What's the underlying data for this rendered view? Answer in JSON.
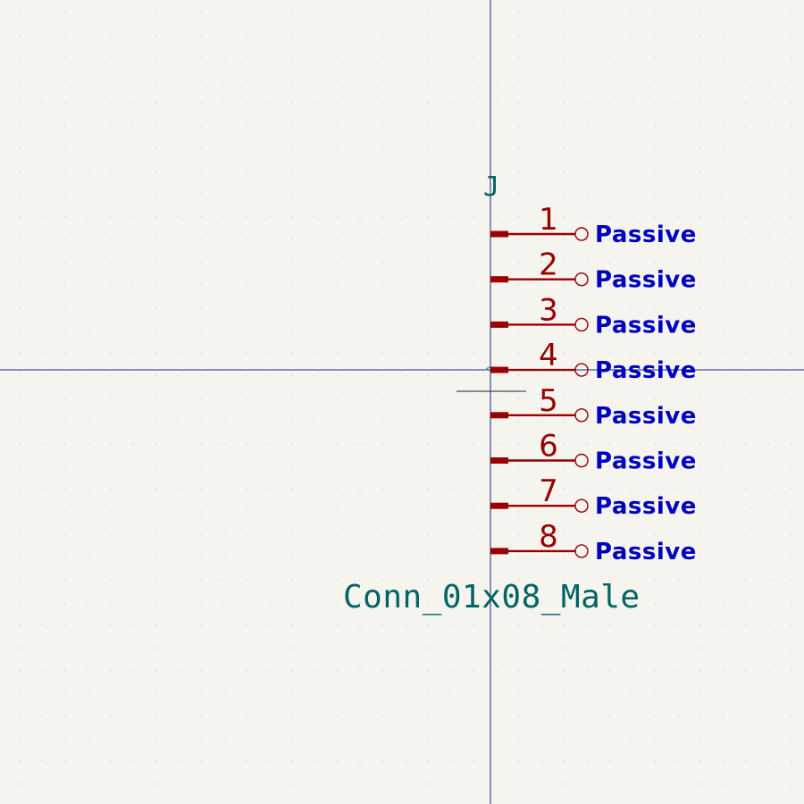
{
  "symbol": {
    "reference": "J",
    "value": "Conn_01x08_Male"
  },
  "pins": [
    {
      "number": "1",
      "type": "Passive"
    },
    {
      "number": "2",
      "type": "Passive"
    },
    {
      "number": "3",
      "type": "Passive"
    },
    {
      "number": "4",
      "type": "Passive"
    },
    {
      "number": "5",
      "type": "Passive"
    },
    {
      "number": "6",
      "type": "Passive"
    },
    {
      "number": "7",
      "type": "Passive"
    },
    {
      "number": "8",
      "type": "Passive"
    }
  ],
  "colors": {
    "background": "#f5f4ef",
    "grid_dot": "#c9c8c2",
    "axis": "#1a237e",
    "pin": "#990000",
    "pin_type": "#0000c0",
    "field_text": "#006464"
  }
}
